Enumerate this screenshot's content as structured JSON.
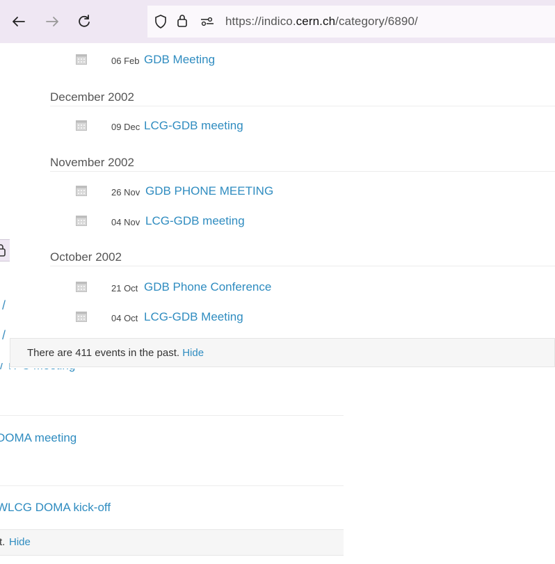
{
  "browser": {
    "url_prefix": "https://indico.",
    "url_host": "cern.ch",
    "url_path": "/category/6890/"
  },
  "colors": {
    "link": "#2f8cc0",
    "toolbar": "#efe7f3",
    "footer_bg": "#f6f6f6"
  },
  "events": {
    "top_partial": {
      "date": "06 Feb",
      "title": "GDB Meeting"
    },
    "months": [
      {
        "label": "December 2002",
        "items": [
          {
            "date": "09 Dec",
            "title": "LCG-GDB meeting"
          }
        ]
      },
      {
        "label": "November 2002",
        "items": [
          {
            "date": "26 Nov",
            "title": "GDB PHONE MEETING"
          },
          {
            "date": "04 Nov",
            "title": "LCG-GDB meeting"
          }
        ]
      },
      {
        "label": "October 2002",
        "items": [
          {
            "date": "21 Oct",
            "title": "GDB Phone Conference"
          },
          {
            "date": "04 Oct",
            "title": "LCG-GDB Meeting"
          }
        ]
      }
    ]
  },
  "past_notice": {
    "text": "There are 411 events in the past.",
    "action": "Hide"
  },
  "back_window": {
    "links": [
      "TPC Meeting",
      "DOMA meeting",
      "WLCG DOMA kick-off"
    ],
    "footer_text": "t.",
    "footer_action": "Hide"
  }
}
